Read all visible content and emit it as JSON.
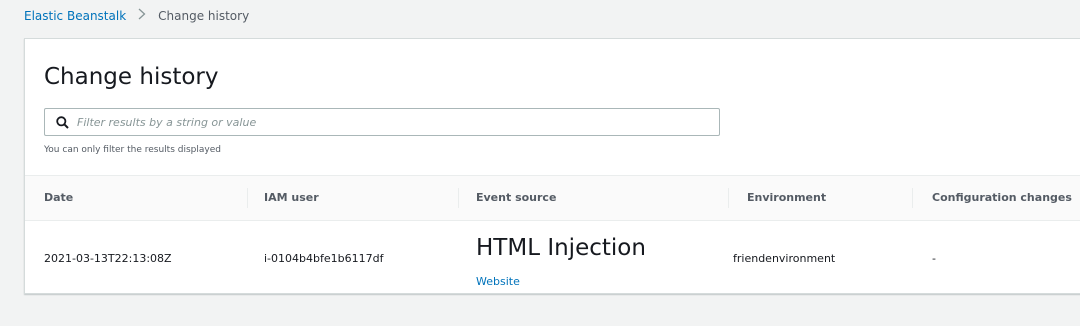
{
  "breadcrumb": {
    "root": "Elastic Beanstalk",
    "separator": ">",
    "current": "Change history"
  },
  "panel": {
    "title": "Change history",
    "filter": {
      "placeholder": "Filter results by a string or value",
      "value": "",
      "hint": "You can only filter the results displayed",
      "icon": "search-icon"
    }
  },
  "table": {
    "columns": [
      "Date",
      "IAM user",
      "Event source",
      "Environment",
      "Configuration changes"
    ],
    "rows": [
      {
        "date": "2021-03-13T22:13:08Z",
        "iam_user": "i-0104b4bfe1b6117df",
        "event_source_heading": "HTML Injection",
        "event_source_link": "Website",
        "environment": "friendenvironment",
        "configuration_changes": "-"
      }
    ]
  },
  "colors": {
    "link": "#0073bb",
    "background": "#f2f3f3",
    "panel": "#ffffff",
    "header_text": "#545b64"
  }
}
